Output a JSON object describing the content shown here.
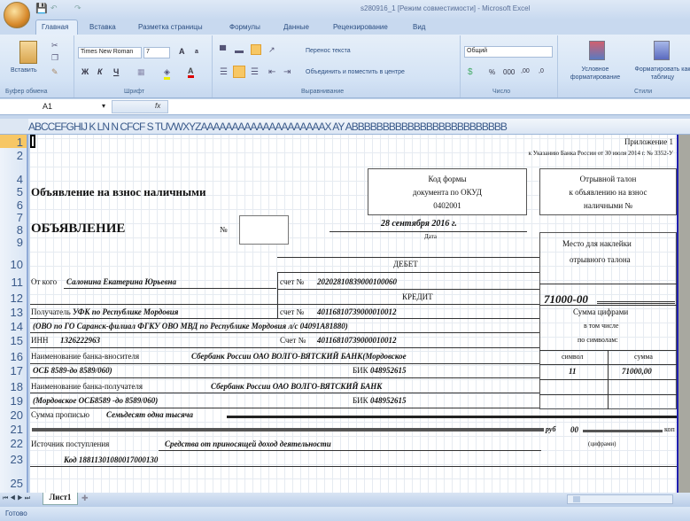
{
  "window": {
    "title": "s280916_1  [Режим совместимости] - Microsoft Excel"
  },
  "tabs": [
    "Главная",
    "Вставка",
    "Разметка страницы",
    "Формулы",
    "Данные",
    "Рецензирование",
    "Вид"
  ],
  "ribbon": {
    "clipboard": {
      "paste": "Вставить",
      "label": "Буфер обмена"
    },
    "font": {
      "name": "Times New Roman",
      "size": "7",
      "label": "Шрифт",
      "bold": "Ж",
      "italic": "К",
      "underline": "Ч",
      "grow": "A",
      "shrink": "a",
      "color": "A"
    },
    "alignment": {
      "wrap": "Перенос текста",
      "merge": "Объединить и поместить в центре",
      "label": "Выравнивание"
    },
    "number": {
      "format": "Общий",
      "percent": "%",
      "thousands": "000",
      "inc": ",00",
      "dec": ",0",
      "label": "Число"
    },
    "styles": {
      "conditional": "Условное форматирование",
      "table": "Форматировать как таблицу",
      "label": "Стили"
    }
  },
  "formula_bar": {
    "cell": "A1",
    "fx": "fx",
    "value": ""
  },
  "column_header": "ABCCEFGHIJ K LN N CFCF S TUVWXYZAAAAAAAAAAAAAAAAAAAAX   AY  ABBBBBBBBBBBBBBBBBBBBBBBBB",
  "row_numbers": [
    "1",
    "2",
    "4",
    "5",
    "6",
    "7",
    "8",
    "9",
    "10",
    "11",
    "12",
    "13",
    "14",
    "15",
    "16",
    "17",
    "18",
    "19",
    "20",
    "21",
    "22",
    "23",
    "25"
  ],
  "form": {
    "appendix": "Приложение 1",
    "appendix_ref": "к Указанию Банка России от 30 июля 2014 г. № 3352-У",
    "title": "Объявление на взнос наличными",
    "okud": [
      "Код формы",
      "документа по ОКУД",
      "0402001"
    ],
    "stub": [
      "Отрывной талон",
      "к объявлению на взнос",
      "наличными №"
    ],
    "heading": "ОБЪЯВЛЕНИЕ",
    "no": "№",
    "date": "28 сентября 2016 г.",
    "date_label": "Дата",
    "sticker": [
      "Место для наклейки",
      "отрывного талона"
    ],
    "debit": "ДЕБЕТ",
    "credit": "КРЕДИТ",
    "from_label": "От кого",
    "from": "Салонина Екатерина Юрьевна",
    "account_label": "счет №",
    "debit_account": "20202810839000100060",
    "recipient_label": "Получатель",
    "recipient": "УФК по Республике Мордовия",
    "credit_account": "40116810739000010012",
    "recipient_detail": "(ОВО по ГО Саранск-филиал ФГКУ ОВО МВД по Республике Мордовия  л/с 04091A81880)",
    "inn_label": "ИНН",
    "inn": "1326222963",
    "account_label2": "Счет №",
    "inn_account": "40116810739000010012",
    "payer_bank_label": "Наименование банка-вносителя",
    "payer_bank": "Сбербанк России  ОАО ВОЛГО-ВЯТСКИЙ БАНК(Мордовское",
    "payer_bank2": "ОСБ 8589-до 8589/060)",
    "bik_label": "БИК",
    "bik": "048952615",
    "recv_bank_label": "Наименование банка-получателя",
    "recv_bank": "Сбербанк России ОАО ВОЛГО-ВЯТСКИЙ БАНК",
    "recv_bank2": "(Мордовское ОСБ8589 -до 8589/060)",
    "amount_words_label": "Сумма прописью",
    "amount_words": "Семьдесят одна тысяча",
    "rub": "руб",
    "kop_value": "00",
    "kop": "коп",
    "source_label": "Источник поступления",
    "source": "Средства от приносящей доход деятельности",
    "digits": "(цифрами)",
    "code": "Код 18811301080017000130",
    "amount": "71000-00",
    "amount_digits": "Сумма цифрами",
    "incl": "в том числе",
    "by_symbols": "по символам:",
    "sym_header": [
      "символ",
      "сумма"
    ],
    "sym_row": [
      "11",
      "71000,00"
    ]
  },
  "sheet_tabs": [
    "Лист1"
  ],
  "status": "Готово"
}
